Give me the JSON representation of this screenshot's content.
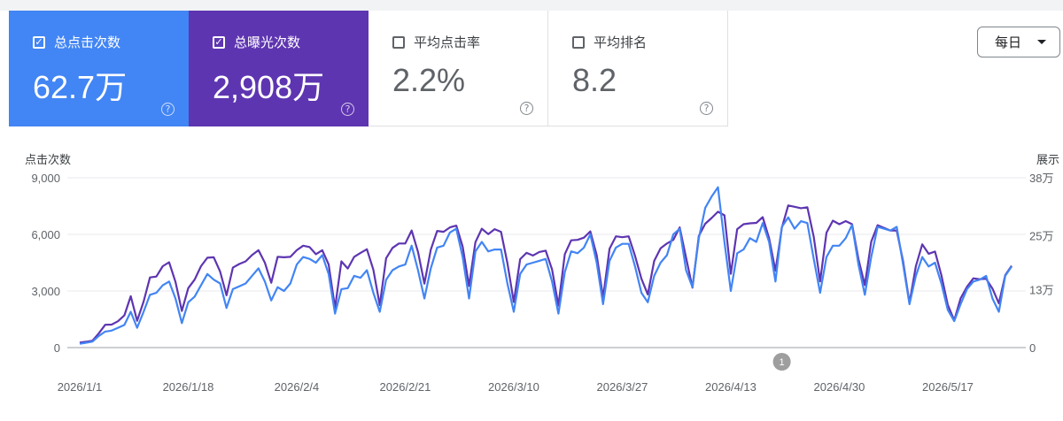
{
  "metrics": [
    {
      "label": "总点击次数",
      "value": "62.7万",
      "checked": true,
      "help": "?"
    },
    {
      "label": "总曝光次数",
      "value": "2,908万",
      "checked": true,
      "help": "?"
    },
    {
      "label": "平均点击率",
      "value": "2.2%",
      "checked": false,
      "help": "?"
    },
    {
      "label": "平均排名",
      "value": "8.2",
      "checked": false,
      "help": "?"
    }
  ],
  "period_select": {
    "value": "每日"
  },
  "colors": {
    "clicks": "#4285f4",
    "impressions": "#5e35b1",
    "card_clicks": "#4285f4",
    "card_impressions": "#5e35b1"
  },
  "icons": {
    "check": "check-icon",
    "help": "help-circle-icon",
    "dropdown": "chevron-down-icon"
  },
  "chart_data": {
    "type": "line",
    "ylabel_left": "点击次数",
    "ylabel_right": "展示",
    "left_ticks": [
      "0",
      "3,000",
      "6,000",
      "9,000"
    ],
    "left_tick_values": [
      0,
      3000,
      6000,
      9000
    ],
    "right_ticks": [
      "0",
      "13万",
      "25万",
      "38万"
    ],
    "right_tick_values": [
      0,
      130000,
      250000,
      380000
    ],
    "ylim_left": [
      0,
      9000
    ],
    "ylim_right": [
      0,
      380000
    ],
    "grid": true,
    "x_start": "2026/1/1",
    "x_ticks": [
      "2026/1/1",
      "2026/1/18",
      "2026/2/4",
      "2026/2/21",
      "2026/3/10",
      "2026/3/27",
      "2026/4/13",
      "2026/4/30",
      "2026/5/17"
    ],
    "x_tick_index": [
      0,
      17,
      34,
      51,
      68,
      85,
      102,
      119,
      136
    ],
    "annotation": {
      "label": "1",
      "index": 110
    },
    "series": [
      {
        "key": "clicks",
        "axis": "left",
        "values": [
          200,
          260,
          320,
          620,
          850,
          900,
          1050,
          1200,
          1900,
          1050,
          1900,
          2800,
          2900,
          3300,
          3500,
          2600,
          1300,
          2400,
          2700,
          3300,
          3900,
          3600,
          3400,
          2100,
          3100,
          3250,
          3400,
          3800,
          4200,
          3500,
          2500,
          3200,
          3000,
          3400,
          4400,
          4800,
          4700,
          4500,
          4900,
          3900,
          1800,
          3100,
          3150,
          3800,
          3700,
          4100,
          2900,
          1900,
          3600,
          4100,
          4300,
          4400,
          5400,
          4100,
          2600,
          4200,
          5300,
          5400,
          6100,
          6300,
          4800,
          2600,
          5100,
          5600,
          5100,
          5200,
          5200,
          3400,
          1900,
          3900,
          4400,
          4500,
          4600,
          4700,
          3500,
          1800,
          4000,
          5100,
          5000,
          5300,
          6000,
          4500,
          2300,
          4600,
          5300,
          5500,
          5500,
          4300,
          2900,
          2400,
          3800,
          4500,
          4900,
          6000,
          6300,
          4100,
          3200,
          5800,
          7400,
          8000,
          8500,
          5600,
          3000,
          5000,
          5200,
          5800,
          5600,
          6600,
          5600,
          3500,
          6400,
          6900,
          6300,
          6700,
          6600,
          4700,
          2900,
          4800,
          5400,
          5400,
          5800,
          6500,
          4400,
          2800,
          4800,
          6400,
          6300,
          6200,
          6400,
          4400,
          2300,
          3800,
          4800,
          4300,
          4500,
          3400,
          2000,
          1400,
          2300,
          3100,
          3500,
          3600,
          3800,
          2600,
          1900,
          3800,
          4300
        ]
      },
      {
        "key": "impressions",
        "axis": "right",
        "values": [
          11000,
          13000,
          15500,
          32000,
          51000,
          51500,
          59000,
          72000,
          115000,
          60000,
          103000,
          157000,
          159000,
          182000,
          191000,
          147000,
          82000,
          133000,
          152000,
          182000,
          201000,
          202000,
          170000,
          117000,
          179000,
          187000,
          193000,
          207000,
          218000,
          190000,
          145000,
          203000,
          202000,
          203000,
          218000,
          228000,
          225000,
          209000,
          218000,
          186000,
          89000,
          193000,
          177000,
          203000,
          212000,
          220000,
          174000,
          95000,
          200000,
          223000,
          233000,
          233000,
          262000,
          214000,
          143000,
          219000,
          261000,
          259000,
          269000,
          273000,
          226000,
          138000,
          236000,
          266000,
          254000,
          265000,
          259000,
          189000,
          102000,
          198000,
          212000,
          206000,
          214000,
          217000,
          175000,
          94000,
          209000,
          240000,
          241000,
          246000,
          260000,
          207000,
          112000,
          221000,
          249000,
          247000,
          249000,
          205000,
          154000,
          119000,
          194000,
          222000,
          233000,
          241000,
          269000,
          201000,
          134000,
          250000,
          277000,
          290000,
          304000,
          296000,
          165000,
          265000,
          276000,
          278000,
          279000,
          292000,
          245000,
          172000,
          268000,
          318000,
          315000,
          312000,
          314000,
          248000,
          148000,
          257000,
          284000,
          276000,
          283000,
          276000,
          198000,
          140000,
          237000,
          274000,
          268000,
          262000,
          262000,
          193000,
          100000,
          182000,
          231000,
          210000,
          215000,
          162000,
          96000,
          61000,
          110000,
          136000,
          155000,
          153000,
          154000,
          132000,
          99000,
          162000,
          183000
        ]
      }
    ]
  }
}
